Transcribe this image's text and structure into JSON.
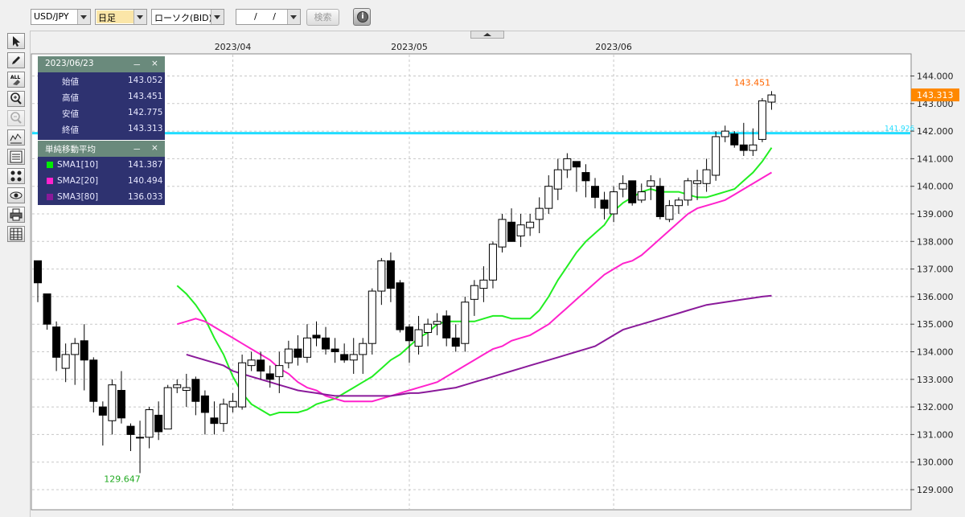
{
  "toolbar": {
    "symbol": "USD/JPY",
    "period": "日足",
    "chart_type": "ローソク(BID)",
    "date_input": "/ /",
    "search_label": "検索",
    "info_icon": "i"
  },
  "sidebar_tools": [
    "cursor-icon",
    "pencil-icon",
    "erase-all-icon",
    "zoom-in-icon",
    "zoom-out-icon",
    "indicator-icon",
    "price-list-icon",
    "pattern-icon",
    "eye-icon",
    "print-icon",
    "table-icon"
  ],
  "ohlc_panel": {
    "date": "2023/06/23",
    "minimize": "－",
    "close": "×",
    "rows": [
      {
        "label": "始値",
        "value": "143.052"
      },
      {
        "label": "高値",
        "value": "143.451"
      },
      {
        "label": "安値",
        "value": "142.775"
      },
      {
        "label": "終値",
        "value": "143.313"
      }
    ]
  },
  "sma_panel": {
    "title": "単純移動平均",
    "minimize": "－",
    "close": "×",
    "rows": [
      {
        "label": "SMA1[10]",
        "value": "141.387",
        "color": "#00ee00"
      },
      {
        "label": "SMA2[20]",
        "value": "140.494",
        "color": "#ff22cc"
      },
      {
        "label": "SMA3[80]",
        "value": "136.033",
        "color": "#8a1a9a"
      }
    ]
  },
  "annotations": {
    "high_label": "143.451",
    "low_label": "129.647",
    "current_price": "143.313",
    "hline_label": "141.926"
  },
  "colors": {
    "sma1": "#22ee22",
    "sma2": "#ff22cc",
    "sma3": "#8a1a9a",
    "hline": "#22ddff",
    "high": "#ff6600",
    "low": "#22aa22",
    "price_tag": "#ff8800"
  },
  "chart_data": {
    "type": "candlestick",
    "title": "",
    "xlabel": "",
    "ylabel": "",
    "ylim": [
      128.6,
      144.9
    ],
    "yticks": [
      129,
      130,
      131,
      132,
      133,
      134,
      135,
      136,
      137,
      138,
      139,
      140,
      141,
      142,
      143,
      144
    ],
    "ytick_labels": [
      "129.000",
      "130.000",
      "131.000",
      "132.000",
      "133.000",
      "134.000",
      "135.000",
      "136.000",
      "137.000",
      "138.000",
      "139.000",
      "140.000",
      "141.000",
      "142.000",
      "143.000",
      "144.000"
    ],
    "x_tick_labels": [
      {
        "label": "2023/04",
        "index": 21
      },
      {
        "label": "2023/05",
        "index": 40
      },
      {
        "label": "2023/06",
        "index": 62
      }
    ],
    "horizontal_line": 141.926,
    "ohlc": [
      [
        137.3,
        137.3,
        135.8,
        136.5
      ],
      [
        136.1,
        136.1,
        134.8,
        135.0
      ],
      [
        134.9,
        135.1,
        133.3,
        133.8
      ],
      [
        133.4,
        134.3,
        132.9,
        133.9
      ],
      [
        133.9,
        134.5,
        132.8,
        134.3
      ],
      [
        134.4,
        135.0,
        132.6,
        133.7
      ],
      [
        133.7,
        133.8,
        131.8,
        132.2
      ],
      [
        132.0,
        132.2,
        130.6,
        131.7
      ],
      [
        131.5,
        133.0,
        131.0,
        132.8
      ],
      [
        132.6,
        133.3,
        131.4,
        131.6
      ],
      [
        131.3,
        131.4,
        130.4,
        131.0
      ],
      [
        130.9,
        131.5,
        129.6,
        130.9
      ],
      [
        130.9,
        132.0,
        130.5,
        131.9
      ],
      [
        131.7,
        132.2,
        130.8,
        131.1
      ],
      [
        131.2,
        132.8,
        131.2,
        132.7
      ],
      [
        132.7,
        133.0,
        132.5,
        132.8
      ],
      [
        132.6,
        133.2,
        132.0,
        132.7
      ],
      [
        133.0,
        133.1,
        131.7,
        132.2
      ],
      [
        132.4,
        132.6,
        131.0,
        131.8
      ],
      [
        131.6,
        132.2,
        131.0,
        131.4
      ],
      [
        131.4,
        132.3,
        131.1,
        132.1
      ],
      [
        132.0,
        132.5,
        131.8,
        132.2
      ],
      [
        132.0,
        133.9,
        131.9,
        133.6
      ],
      [
        133.5,
        134.0,
        133.3,
        133.7
      ],
      [
        133.7,
        134.0,
        133.0,
        133.3
      ],
      [
        133.2,
        133.5,
        132.7,
        133.0
      ],
      [
        133.1,
        134.0,
        132.5,
        133.5
      ],
      [
        133.6,
        134.4,
        133.4,
        134.1
      ],
      [
        134.1,
        134.6,
        133.5,
        133.8
      ],
      [
        133.8,
        135.0,
        133.6,
        134.5
      ],
      [
        134.6,
        135.1,
        134.2,
        134.5
      ],
      [
        134.5,
        134.9,
        133.9,
        134.1
      ],
      [
        134.1,
        134.5,
        133.6,
        134.0
      ],
      [
        133.9,
        134.3,
        133.6,
        133.7
      ],
      [
        133.7,
        134.5,
        133.2,
        133.9
      ],
      [
        133.9,
        134.5,
        133.2,
        134.3
      ],
      [
        134.3,
        136.3,
        133.9,
        136.2
      ],
      [
        136.2,
        137.4,
        135.7,
        137.3
      ],
      [
        137.3,
        137.6,
        135.8,
        136.3
      ],
      [
        136.5,
        136.6,
        134.7,
        134.8
      ],
      [
        134.9,
        135.0,
        133.6,
        134.4
      ],
      [
        134.2,
        135.3,
        133.9,
        134.8
      ],
      [
        134.7,
        135.2,
        134.2,
        135.0
      ],
      [
        135.0,
        135.4,
        134.6,
        135.1
      ],
      [
        135.3,
        135.5,
        134.2,
        134.5
      ],
      [
        134.5,
        135.0,
        134.0,
        134.2
      ],
      [
        134.3,
        136.0,
        134.0,
        135.8
      ],
      [
        135.9,
        136.6,
        135.3,
        136.4
      ],
      [
        136.3,
        137.1,
        135.8,
        136.6
      ],
      [
        136.6,
        138.0,
        136.3,
        137.9
      ],
      [
        137.8,
        139.0,
        137.6,
        138.8
      ],
      [
        138.7,
        139.2,
        138.1,
        138.0
      ],
      [
        138.2,
        139.0,
        137.8,
        138.6
      ],
      [
        138.5,
        139.0,
        138.2,
        138.7
      ],
      [
        138.8,
        139.6,
        138.3,
        139.2
      ],
      [
        139.2,
        140.4,
        139.0,
        140.0
      ],
      [
        139.9,
        141.0,
        139.5,
        140.6
      ],
      [
        140.6,
        141.2,
        140.3,
        141.0
      ],
      [
        140.9,
        140.9,
        139.8,
        140.7
      ],
      [
        140.5,
        140.8,
        139.6,
        140.2
      ],
      [
        140.0,
        140.3,
        139.2,
        139.6
      ],
      [
        139.5,
        139.8,
        138.8,
        139.2
      ],
      [
        139.0,
        140.0,
        138.7,
        139.8
      ],
      [
        139.9,
        140.4,
        139.6,
        140.1
      ],
      [
        140.2,
        140.2,
        139.3,
        139.4
      ],
      [
        139.5,
        140.1,
        139.4,
        139.8
      ],
      [
        140.0,
        140.4,
        139.5,
        140.2
      ],
      [
        140.0,
        140.3,
        138.8,
        138.9
      ],
      [
        138.8,
        139.5,
        138.7,
        139.3
      ],
      [
        139.3,
        139.6,
        139.0,
        139.5
      ],
      [
        139.5,
        140.3,
        139.3,
        140.2
      ],
      [
        140.1,
        140.6,
        139.5,
        140.2
      ],
      [
        140.1,
        141.0,
        139.8,
        140.6
      ],
      [
        140.4,
        142.0,
        140.2,
        141.8
      ],
      [
        141.8,
        142.2,
        141.6,
        142.0
      ],
      [
        141.9,
        142.0,
        141.4,
        141.5
      ],
      [
        141.5,
        142.3,
        141.1,
        141.3
      ],
      [
        141.3,
        142.1,
        141.1,
        141.5
      ],
      [
        141.7,
        143.2,
        141.6,
        143.1
      ],
      [
        143.052,
        143.451,
        142.775,
        143.313
      ]
    ],
    "series": [
      {
        "name": "SMA1[10]",
        "values": [
          null,
          null,
          null,
          null,
          null,
          null,
          null,
          null,
          null,
          136.4,
          136.1,
          135.7,
          135.2,
          134.5,
          133.9,
          133.1,
          132.5,
          132.1,
          131.9,
          131.7,
          131.8,
          131.8,
          131.8,
          131.9,
          132.1,
          132.2,
          132.3,
          132.5,
          132.7,
          132.9,
          133.1,
          133.4,
          133.7,
          133.9,
          134.2,
          134.5,
          134.7,
          135.0,
          135.1,
          135.1,
          135.1,
          135.1,
          135.2,
          135.3,
          135.3,
          135.2,
          135.2,
          135.2,
          135.5,
          136.0,
          136.6,
          137.1,
          137.6,
          138.0,
          138.3,
          138.6,
          139.1,
          139.4,
          139.6,
          139.8,
          139.9,
          139.8,
          139.8,
          139.8,
          139.7,
          139.6,
          139.6,
          139.7,
          139.8,
          139.9,
          140.2,
          140.5,
          140.9,
          141.4
        ]
      },
      {
        "name": "SMA2[20]",
        "values": [
          135.0,
          135.1,
          135.2,
          135.1,
          134.9,
          134.7,
          134.5,
          134.3,
          134.1,
          133.9,
          133.7,
          133.4,
          133.2,
          132.9,
          132.7,
          132.6,
          132.4,
          132.3,
          132.2,
          132.2,
          132.2,
          132.2,
          132.3,
          132.4,
          132.5,
          132.6,
          132.7,
          132.8,
          132.9,
          133.1,
          133.3,
          133.5,
          133.7,
          133.9,
          134.1,
          134.2,
          134.4,
          134.5,
          134.6,
          134.8,
          135.0,
          135.3,
          135.6,
          135.9,
          136.2,
          136.5,
          136.8,
          137.0,
          137.2,
          137.3,
          137.5,
          137.8,
          138.1,
          138.4,
          138.7,
          139.0,
          139.2,
          139.3,
          139.4,
          139.5,
          139.7,
          139.9,
          140.1,
          140.3,
          140.5
        ]
      },
      {
        "name": "SMA3[80]",
        "values": [
          133.9,
          133.8,
          133.7,
          133.6,
          133.5,
          133.3,
          133.2,
          133.1,
          133.0,
          132.9,
          132.8,
          132.7,
          132.6,
          132.55,
          132.5,
          132.45,
          132.4,
          132.4,
          132.4,
          132.4,
          132.4,
          132.4,
          132.4,
          132.45,
          132.5,
          132.5,
          132.55,
          132.6,
          132.65,
          132.7,
          132.8,
          132.9,
          133.0,
          133.1,
          133.2,
          133.3,
          133.4,
          133.5,
          133.6,
          133.7,
          133.8,
          133.9,
          134.0,
          134.1,
          134.2,
          134.4,
          134.6,
          134.8,
          134.9,
          135.0,
          135.1,
          135.2,
          135.3,
          135.4,
          135.5,
          135.6,
          135.7,
          135.75,
          135.8,
          135.85,
          135.9,
          135.95,
          136.0,
          136.033
        ]
      }
    ]
  }
}
